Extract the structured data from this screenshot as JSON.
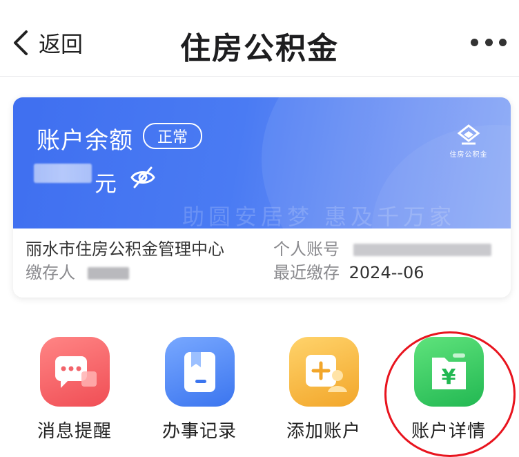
{
  "header": {
    "back_label": "返回",
    "title": "住房公积金"
  },
  "card": {
    "balance_label": "账户余额",
    "status": "正常",
    "currency_unit": "元",
    "logo_name": "住房公积金",
    "slogan": "助圆安居梦 惠及千万家",
    "center_name": "丽水市住房公积金管理中心",
    "depositor_label": "缴存人",
    "account_label": "个人账号",
    "last_deposit_label": "最近缴存",
    "last_deposit_value": "2024--06"
  },
  "actions": [
    {
      "label": "消息提醒",
      "icon": "message-icon"
    },
    {
      "label": "办事记录",
      "icon": "record-icon"
    },
    {
      "label": "添加账户",
      "icon": "add-account-icon"
    },
    {
      "label": "账户详情",
      "icon": "account-detail-icon"
    }
  ],
  "colors": {
    "card_blue": "#4a7bf3",
    "highlight": "#e8141e"
  }
}
